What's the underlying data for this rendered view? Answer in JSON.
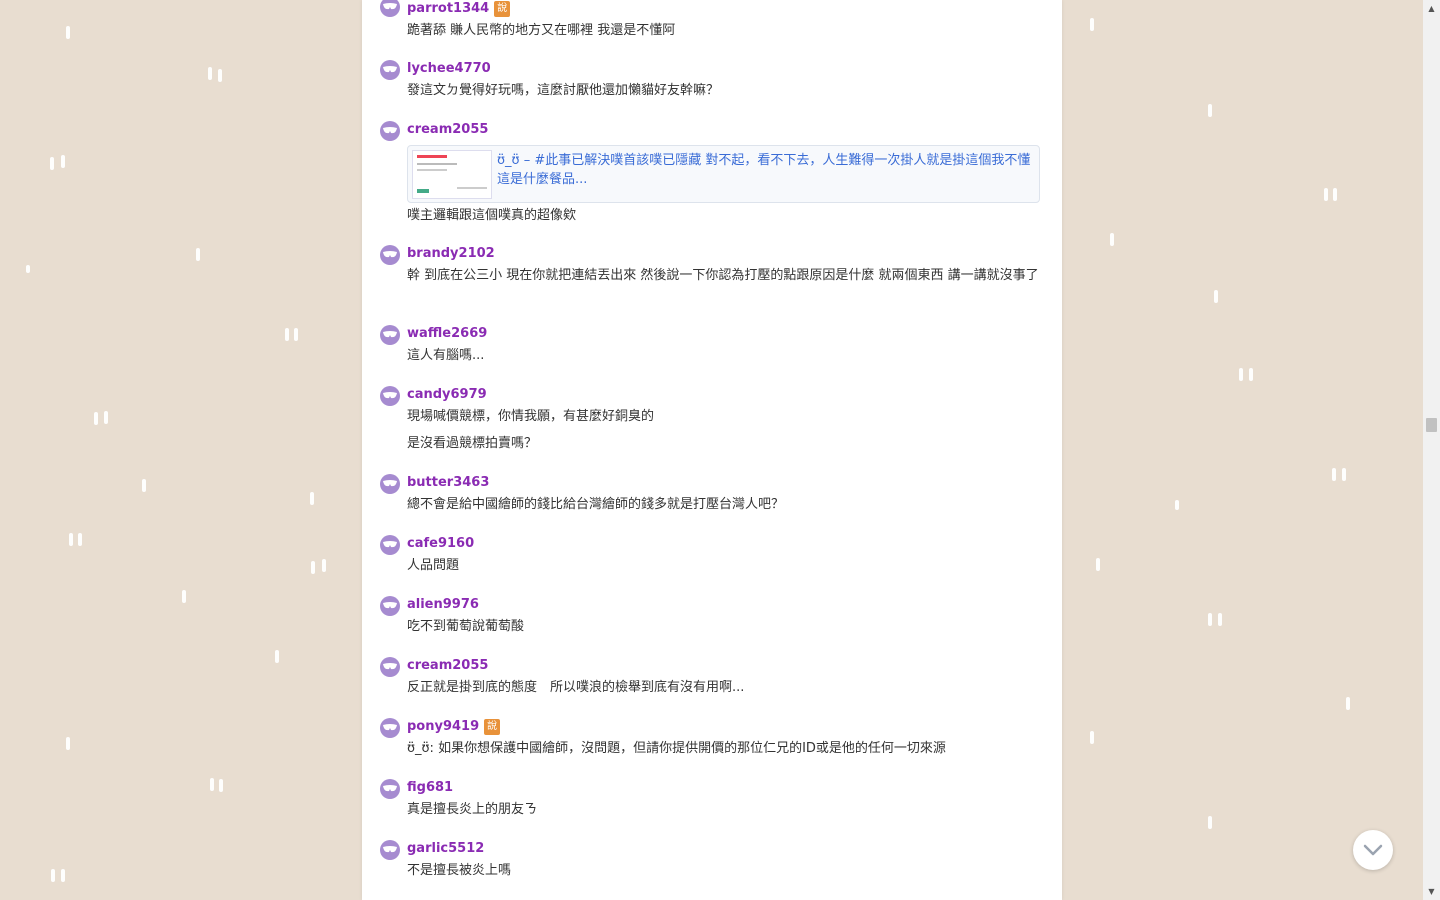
{
  "responses": [
    {
      "user": "parrot1344",
      "badge": "說",
      "text": "跪著舔 賺人民幣的地方又在哪裡 我還是不懂阿"
    },
    {
      "user": "lychee4770",
      "text": "發這文ㄉ覺得好玩嗎，這麼討厭他還加懶貓好友幹嘛？"
    },
    {
      "user": "cream2055",
      "link_title": "ʊ̈_ʊ̈ – #此事已解決噗首該噗已隱藏 對不起，看不下去，人生難得一次掛人就是掛這個我不懂這是什麼餐品...",
      "text": "噗主邏輯跟這個噗真的超像欸"
    },
    {
      "user": "brandy2102",
      "text": "幹 到底在公三小 現在你就把連結丟出來 然後說一下你認為打壓的點跟原因是什麼 就兩個東西 講一講就沒事了"
    },
    {
      "user": "waffle2669",
      "text": "這人有腦嗎..."
    },
    {
      "user": "candy6979",
      "text": "現場喊價競標，你情我願，有甚麼好銅臭的",
      "text2": "是沒看過競標拍賣嗎？"
    },
    {
      "user": "butter3463",
      "text": "總不會是給中國繪師的錢比給台灣繪師的錢多就是打壓台灣人吧？"
    },
    {
      "user": "cafe9160",
      "text": "人品問題"
    },
    {
      "user": "alien9976",
      "text": "吃不到葡萄說葡萄酸"
    },
    {
      "user": "cream2055",
      "text": "反正就是掛到底的態度　所以噗浪的檢舉到底有沒有用啊..."
    },
    {
      "user": "pony9419",
      "badge": "說",
      "text": "ʊ̈_ʊ̈: 如果你想保護中國繪師，沒問題，但請你提供開價的那位仁兄的ID或是他的任何一切來源"
    },
    {
      "user": "fig681",
      "text": "真是擅長炎上的朋友ㄋ"
    },
    {
      "user": "garlic5512",
      "text": "不是擅長被炎上嗎"
    }
  ],
  "colors": {
    "background": "#e8ddd0",
    "username": "#8a2bb3",
    "avatar": "#a68bd0",
    "badge": "#e8923a",
    "link": "#3a6cd6"
  }
}
